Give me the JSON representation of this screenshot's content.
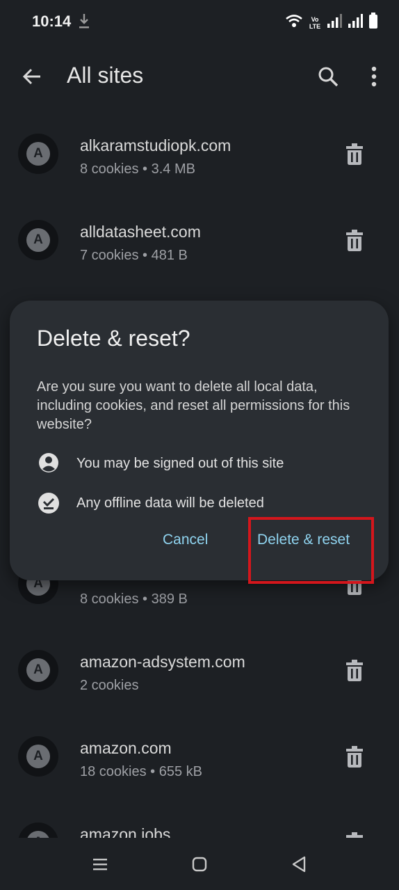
{
  "status_bar": {
    "time": "10:14",
    "network_label": "Vo LTE",
    "icons": [
      "download-icon",
      "wifi-icon",
      "signal-icon",
      "battery-icon"
    ]
  },
  "app_bar": {
    "title": "All sites",
    "icons": [
      "back-arrow-icon",
      "search-icon",
      "more-vert-icon"
    ]
  },
  "sites": [
    {
      "initial": "A",
      "domain": "alkaramstudiopk.com",
      "meta": "8 cookies • 3.4 MB"
    },
    {
      "initial": "A",
      "domain": "alldatasheet.com",
      "meta": "7 cookies • 481 B"
    },
    {
      "initial": "A",
      "domain": "",
      "meta": "8 cookies • 389 B"
    },
    {
      "initial": "A",
      "domain": "amazon-adsystem.com",
      "meta": "2 cookies"
    },
    {
      "initial": "A",
      "domain": "amazon.com",
      "meta": "18 cookies • 655 kB"
    },
    {
      "initial": "A",
      "domain": "amazon.jobs",
      "meta": ""
    }
  ],
  "dialog": {
    "title": "Delete & reset?",
    "body": "Are you sure you want to delete all local data, including cookies, and reset all permissions for this website?",
    "items": [
      {
        "icon": "account-circle-icon",
        "text": "You may be signed out of this site"
      },
      {
        "icon": "offline-check-icon",
        "text": "Any offline data will be deleted"
      }
    ],
    "cancel_label": "Cancel",
    "confirm_label": "Delete & reset"
  },
  "colors": {
    "background": "#1d2024",
    "dialog": "#2a2e33",
    "accent": "#8fd3ef",
    "highlight": "#d4161c"
  }
}
